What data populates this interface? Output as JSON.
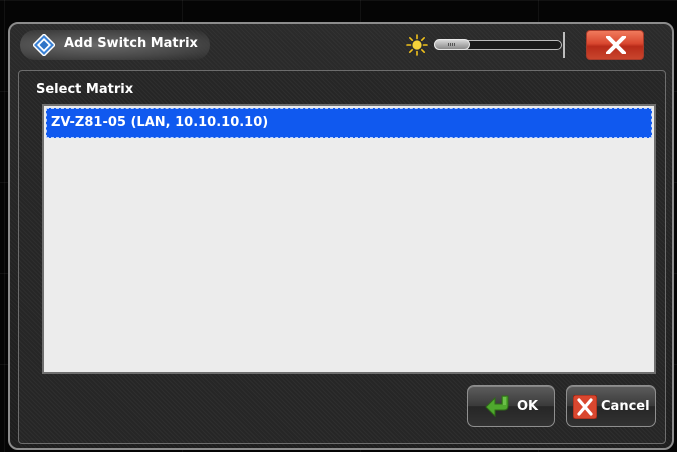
{
  "dialog": {
    "title": "Add Switch Matrix",
    "section_label": "Select Matrix",
    "close_symbol": "X"
  },
  "list": {
    "items": [
      {
        "label": "ZV-Z81-05 (LAN, 10.10.10.10)",
        "selected": true
      }
    ]
  },
  "buttons": {
    "ok_label": "OK",
    "cancel_label": "Cancel"
  },
  "brightness": {
    "level": 0.25
  },
  "icons": {
    "logo": "rohde-schwarz-logo-icon",
    "brightness": "sun-icon",
    "close": "close-icon",
    "ok": "green-arrow-icon",
    "cancel": "red-x-icon"
  },
  "colors": {
    "selection": "#1059ef",
    "close_button": "#d9472f",
    "list_background": "#ececec",
    "dialog_background": "#262626"
  }
}
